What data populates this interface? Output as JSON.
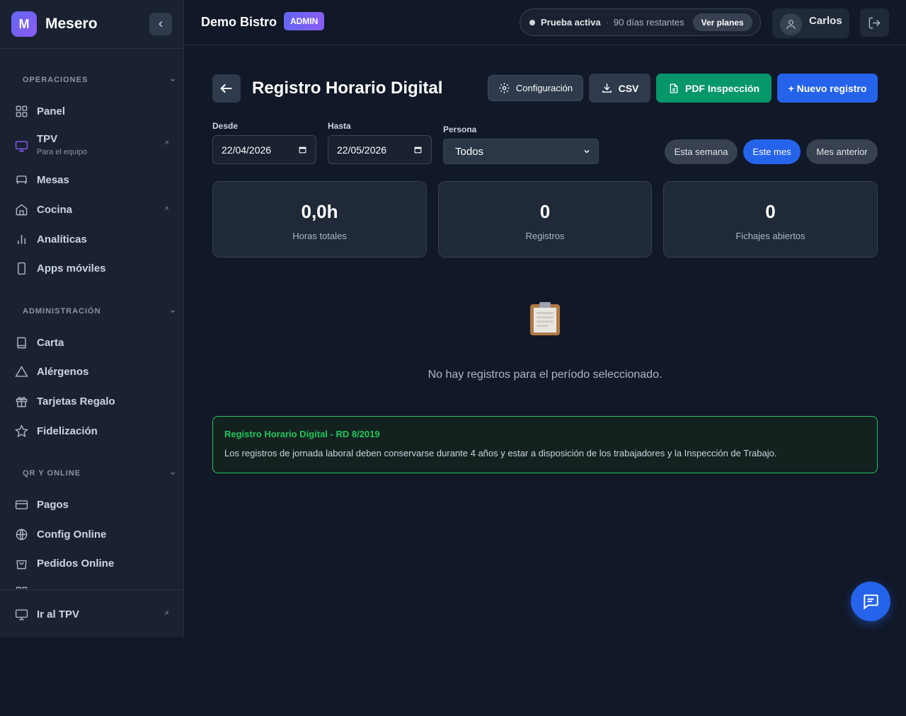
{
  "brand": {
    "initial": "M",
    "name": "Mesero"
  },
  "sidebar": {
    "sections": [
      {
        "title": "OPERACIONES",
        "items": [
          {
            "label": "Panel",
            "icon": "grid-icon"
          },
          {
            "label": "TPV",
            "sublabel": "Para el equipo",
            "icon": "monitor-icon",
            "external": true
          },
          {
            "label": "Mesas",
            "icon": "table-icon"
          },
          {
            "label": "Cocina",
            "icon": "home-icon",
            "external": true
          },
          {
            "label": "Analíticas",
            "icon": "bar-chart-icon"
          },
          {
            "label": "Apps móviles",
            "icon": "phone-icon"
          }
        ]
      },
      {
        "title": "ADMINISTRACIÓN",
        "items": [
          {
            "label": "Carta",
            "icon": "book-icon"
          },
          {
            "label": "Alérgenos",
            "icon": "warning-icon"
          },
          {
            "label": "Tarjetas Regalo",
            "icon": "gift-icon"
          },
          {
            "label": "Fidelización",
            "icon": "star-icon"
          }
        ]
      },
      {
        "title": "QR Y ONLINE",
        "items": [
          {
            "label": "Pagos",
            "icon": "credit-card-icon"
          },
          {
            "label": "Config Online",
            "icon": "globe-icon"
          },
          {
            "label": "Pedidos Online",
            "icon": "shopping-bag-icon"
          }
        ]
      }
    ],
    "footer": {
      "label": "Ir al TPV",
      "icon": "monitor-icon"
    }
  },
  "topbar": {
    "org_name": "Demo Bistro",
    "role_badge": "ADMIN",
    "trial": {
      "status": "Prueba activa",
      "separator": "·",
      "days_left": "90 días restantes",
      "button": "Ver planes"
    },
    "user_name": "Carlos"
  },
  "page": {
    "title": "Registro Horario Digital",
    "buttons": {
      "config": "Configuración",
      "csv": "CSV",
      "pdf": "PDF Inspección",
      "new": "+ Nuevo registro"
    }
  },
  "filters": {
    "from_label": "Desde",
    "from_value": "22/04/2026",
    "to_label": "Hasta",
    "to_value": "22/05/2026",
    "person_label": "Persona",
    "person_value": "Todos",
    "ranges": [
      "Esta semana",
      "Este mes",
      "Mes anterior"
    ],
    "active_range": "Este mes"
  },
  "stats": [
    {
      "value": "0,0h",
      "caption": "Horas totales"
    },
    {
      "value": "0",
      "caption": "Registros"
    },
    {
      "value": "0",
      "caption": "Fichajes abiertos"
    }
  ],
  "empty_state": {
    "icon": "clipboard-icon",
    "message": "No hay registros para el período seleccionado."
  },
  "notice": {
    "title": "Registro Horario Digital - RD 8/2019",
    "body": "Los registros de jornada laboral deben conservarse durante 4 años y estar a disposición de los trabajadores y la Inspección de Trabajo."
  },
  "colors": {
    "background": "#111827",
    "sidebar": "#1a2231",
    "primary": "#2563eb",
    "success": "#059669",
    "notice_accent": "#22c55e",
    "admin_badge": "#6366f1"
  }
}
